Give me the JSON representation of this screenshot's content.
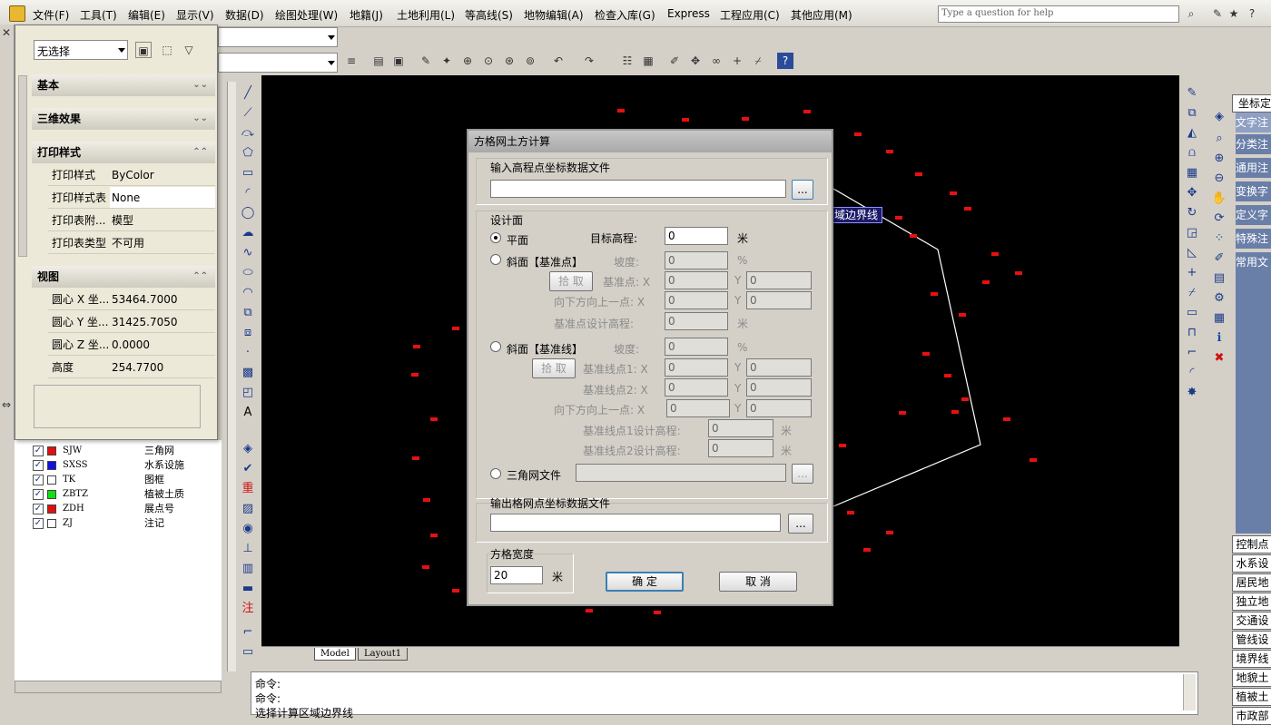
{
  "menu": {
    "items": [
      "文件(F)",
      "工具(T)",
      "编辑(E)",
      "显示(V)",
      "数据(D)",
      "绘图处理(W)",
      "地籍(J)",
      "土地利用(L)",
      "等高线(S)",
      "地物编辑(A)",
      "检查入库(G)",
      "Express",
      "工程应用(C)",
      "其他应用(M)"
    ],
    "search_placeholder": "Type a question for help"
  },
  "properties": {
    "selection": "无选择",
    "sections": {
      "basic": "基本",
      "three_d": "三维效果",
      "print_style": "打印样式",
      "view": "视图"
    },
    "print_rows": [
      {
        "key": "打印样式",
        "value": "ByColor"
      },
      {
        "key": "打印样式表",
        "value": "None"
      },
      {
        "key": "打印表附...",
        "value": "模型"
      },
      {
        "key": "打印表类型",
        "value": "不可用"
      }
    ],
    "view_rows": [
      {
        "key": "圆心 X 坐...",
        "value": "53464.7000"
      },
      {
        "key": "圆心 Y 坐...",
        "value": "31425.7050"
      },
      {
        "key": "圆心 Z 坐...",
        "value": "0.0000"
      },
      {
        "key": "高度",
        "value": "254.7700"
      }
    ]
  },
  "layers": [
    {
      "code": "SJW",
      "name": "三角网",
      "color": "#e01010"
    },
    {
      "code": "SXSS",
      "name": "水系设施",
      "color": "#1010e0"
    },
    {
      "code": "TK",
      "name": "图框",
      "color": "#ffffff"
    },
    {
      "code": "ZBTZ",
      "name": "植被土质",
      "color": "#10e010"
    },
    {
      "code": "ZDH",
      "name": "展点号",
      "color": "#e01010"
    },
    {
      "code": "ZJ",
      "name": "注记",
      "color": "#ffffff"
    }
  ],
  "canvas": {
    "boundary_label": "域边界线",
    "tabs": [
      "Model",
      "Layout1"
    ]
  },
  "command": {
    "lines": [
      "命令:",
      "命令:"
    ],
    "prompt": "选择计算区域边界线"
  },
  "dialog": {
    "title": "方格网土方计算",
    "input_file_label": "输入高程点坐标数据文件",
    "input_file_value": "",
    "browse": "...",
    "design_surface_label": "设计面",
    "plane": {
      "label": "平面",
      "target_elev_label": "目标高程:",
      "target_elev_value": "0",
      "unit_m": "米"
    },
    "slope_point": {
      "label": "斜面【基准点】",
      "slope_label": "坡度:",
      "slope_value": "0",
      "percent": "%",
      "pick": "拾 取",
      "base_point_label": "基准点: X",
      "base_x": "0",
      "y_label": "Y",
      "base_y": "0",
      "down_up_label": "向下方向上一点: X",
      "down_x": "0",
      "down_y": "0",
      "base_elev_label": "基准点设计高程:",
      "base_elev_value": "0",
      "unit_m": "米"
    },
    "slope_line": {
      "label": "斜面【基准线】",
      "slope_label": "坡度:",
      "slope_value": "0",
      "percent": "%",
      "pick": "拾 取",
      "line1_label": "基准线点1: X",
      "line1_x": "0",
      "line1_y": "0",
      "line2_label": "基准线点2: X",
      "line2_x": "0",
      "line2_y": "0",
      "down_up_label": "向下方向上一点: X",
      "down_x": "0",
      "down_y": "0",
      "line1_elev_label": "基准线点1设计高程:",
      "line1_elev_value": "0",
      "line2_elev_label": "基准线点2设计高程:",
      "line2_elev_value": "0",
      "y_label": "Y",
      "unit_m": "米"
    },
    "tin_file": {
      "label": "三角网文件",
      "value": ""
    },
    "output_file_label": "输出格网点坐标数据文件",
    "output_file_value": "",
    "grid_width_label": "方格宽度",
    "grid_width_value": "20",
    "grid_width_unit": "米",
    "ok": "确 定",
    "cancel": "取 消"
  },
  "right_panel": {
    "header": "坐标定",
    "items": [
      "文字注",
      "分类注",
      "通用注",
      "变换字",
      "定义字",
      "特殊注",
      "常用文"
    ],
    "buttons": [
      "控制点",
      "水系设",
      "居民地",
      "独立地",
      "交通设",
      "管线设",
      "境界线",
      "地貌土",
      "植被土",
      "市政部"
    ]
  }
}
